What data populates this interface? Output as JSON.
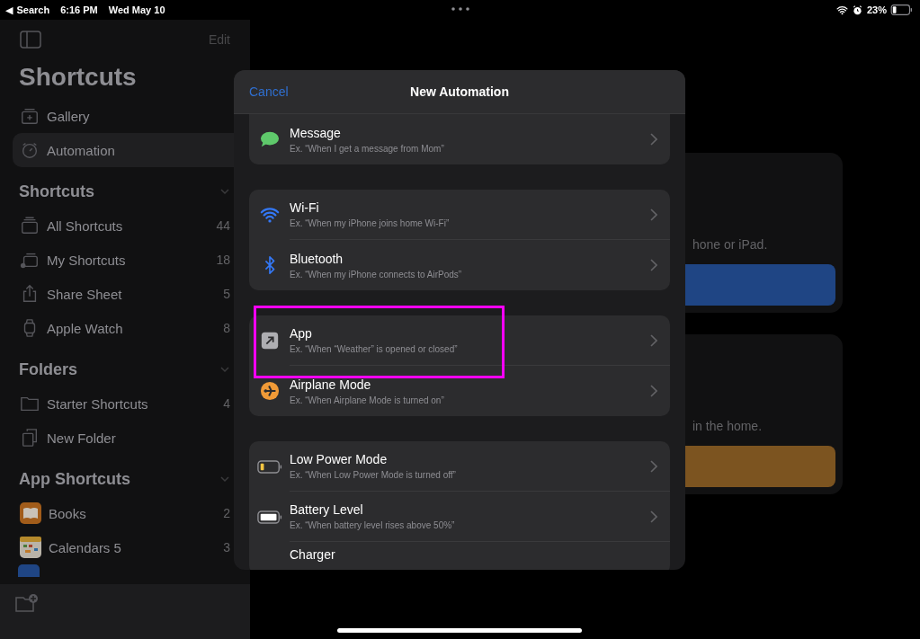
{
  "status_bar": {
    "back_arrow": "◀",
    "back_label": "Search",
    "time": "6:16 PM",
    "date": "Wed May 10",
    "battery": "23%"
  },
  "sidebar": {
    "edit": "Edit",
    "title": "Shortcuts",
    "items": [
      {
        "label": "Gallery",
        "kind": "gallery",
        "selected": false
      },
      {
        "label": "Automation",
        "kind": "automation",
        "selected": true
      }
    ],
    "sections": [
      {
        "title": "Shortcuts",
        "expanded": true,
        "items": [
          {
            "label": "All Shortcuts",
            "count": "44",
            "kind": "stack"
          },
          {
            "label": "My Shortcuts",
            "count": "18",
            "kind": "person"
          },
          {
            "label": "Share Sheet",
            "count": "5",
            "kind": "share"
          },
          {
            "label": "Apple Watch",
            "count": "8",
            "kind": "watch"
          }
        ]
      },
      {
        "title": "Folders",
        "expanded": true,
        "items": [
          {
            "label": "Starter Shortcuts",
            "count": "4",
            "kind": "folder"
          },
          {
            "label": "New Folder",
            "kind": "doc"
          }
        ]
      },
      {
        "title": "App Shortcuts",
        "expanded": true,
        "items": [
          {
            "label": "Books",
            "count": "2",
            "kind": "books"
          },
          {
            "label": "Calendars 5",
            "count": "3",
            "kind": "calendar"
          },
          {
            "kind": "blueapp"
          }
        ]
      }
    ]
  },
  "background_cards": [
    {
      "text": "hone or iPad.",
      "color": "#1f4584"
    },
    {
      "text": "in the home.",
      "color": "#7c5420"
    }
  ],
  "modal": {
    "cancel": "Cancel",
    "title": "New Automation",
    "groups": [
      [
        {
          "title": "Message",
          "subtitle": "Ex. “When I get a message from Mom”",
          "kind": "message",
          "highlighted": false
        }
      ],
      [
        {
          "title": "Wi-Fi",
          "subtitle": "Ex. “When my iPhone joins home Wi-Fi”",
          "kind": "wifi",
          "highlighted": false
        },
        {
          "title": "Bluetooth",
          "subtitle": "Ex. “When my iPhone connects to AirPods”",
          "kind": "bluetooth",
          "highlighted": false
        }
      ],
      [
        {
          "title": "App",
          "subtitle": "Ex. “When “Weather” is opened or closed”",
          "kind": "app",
          "highlighted": true
        },
        {
          "title": "Airplane Mode",
          "subtitle": "Ex. “When Airplane Mode is turned on”",
          "kind": "airplane",
          "highlighted": false
        }
      ],
      [
        {
          "title": "Low Power Mode",
          "subtitle": "Ex. “When Low Power Mode is turned off”",
          "kind": "lowpower",
          "highlighted": false
        },
        {
          "title": "Battery Level",
          "subtitle": "Ex. “When battery level rises above 50%”",
          "kind": "battery",
          "highlighted": false
        },
        {
          "title": "Charger",
          "kind": "charger",
          "highlighted": false
        }
      ]
    ]
  }
}
